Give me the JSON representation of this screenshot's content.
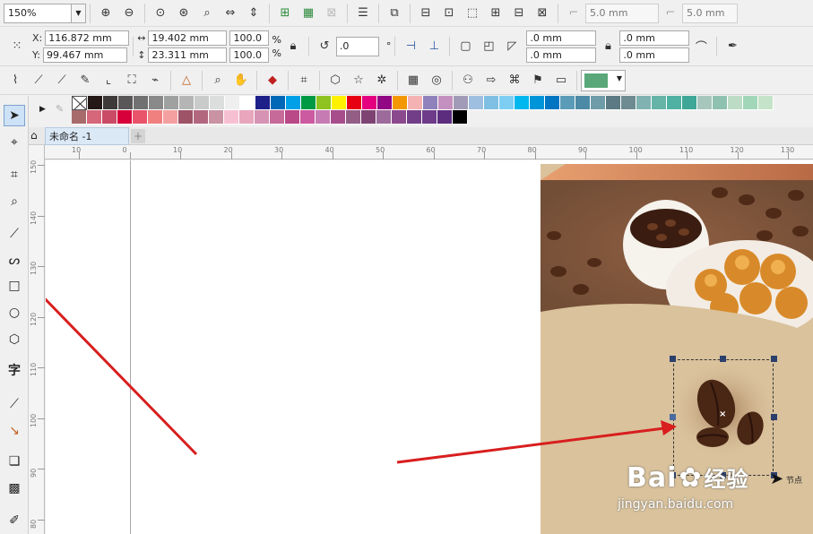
{
  "toolbar_top": {
    "zoom_value": "150%",
    "outline_width_1": "5.0 mm",
    "outline_width_2": "5.0 mm",
    "icons": [
      "zoom-in-icon",
      "zoom-out-icon",
      "zoom-selected-icon",
      "zoom-all-icon",
      "zoom-page-icon",
      "zoom-page-width-icon",
      "zoom-page-height-icon"
    ]
  },
  "property_bar": {
    "x_label": "X:",
    "x_value": "116.872 mm",
    "y_label": "Y:",
    "y_value": "99.467 mm",
    "width_value": "19.402 mm",
    "height_value": "23.311 mm",
    "scale_w": "100.0",
    "scale_h": "100.0",
    "percent_1": "%",
    "percent_2": "%",
    "rotation_value": ".0",
    "degree": "°",
    "corner_1": ".0 mm",
    "corner_2": ".0 mm",
    "corner_3": ".0 mm",
    "corner_4": ".0 mm"
  },
  "fill_color": "#5aa87a",
  "palette_row1": [
    "#231815",
    "#3e3a39",
    "#595757",
    "#727171",
    "#898989",
    "#9fa0a0",
    "#b5b5b6",
    "#c9caca",
    "#dcdddd",
    "#efefef",
    "#ffffff",
    "#1d2088",
    "#0068b7",
    "#00a0e9",
    "#009944",
    "#8fc31f",
    "#fff100",
    "#e60012",
    "#e4007f",
    "#920783",
    "#f39800",
    "#f5b2b2",
    "#8f82bc",
    "#c490bf",
    "#a29bb7",
    "#9ebfe0",
    "#7fbfe3",
    "#7ecef4",
    "#00b7ee",
    "#0095d9",
    "#0075c2",
    "#5a9cb8",
    "#4c8aa6",
    "#6e9ca8",
    "#5b7a83",
    "#6e8b91",
    "#7fb2b0",
    "#66b3a8",
    "#4fb1a1",
    "#3fa797",
    "#a7c7bd",
    "#8fc1b0",
    "#bddcc6",
    "#a1d6b9",
    "#c5e3c8"
  ],
  "palette_row2": [
    "#a76b6b",
    "#d6667a",
    "#c94b65",
    "#d7003a",
    "#e9546b",
    "#f08080",
    "#f4a0a0",
    "#9e5367",
    "#b2677f",
    "#c993a3",
    "#f7c0d2",
    "#e8a6bd",
    "#d793b3",
    "#c66a9a",
    "#b94987",
    "#cc5aa0",
    "#c77bb3",
    "#a74d8c",
    "#935e86",
    "#7e4373",
    "#9d6b9b",
    "#8c4a8e",
    "#733e88",
    "#6d3b89",
    "#5c2c7e",
    "#000000"
  ],
  "document_tab": "未命名 -1",
  "ruler_h": [
    "10",
    "0",
    "10",
    "20",
    "30",
    "40",
    "50",
    "60",
    "70",
    "80",
    "90",
    "100",
    "110",
    "120",
    "130"
  ],
  "ruler_v": [
    "150",
    "140",
    "130",
    "120",
    "110",
    "100",
    "90",
    "80"
  ],
  "tooltip_node": "节点",
  "watermark_main": "Bai",
  "watermark_sub": "经验",
  "watermark_url": "jingyan.baidu.com"
}
